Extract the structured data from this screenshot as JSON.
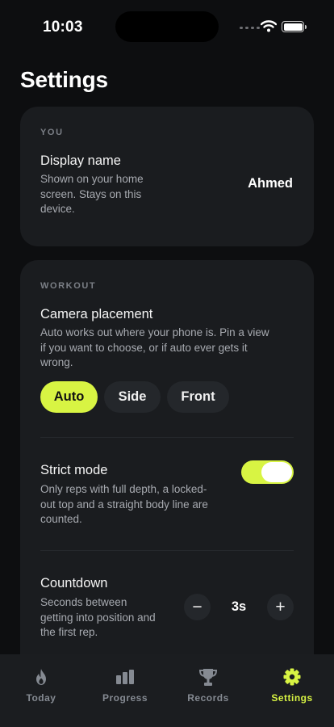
{
  "status_bar": {
    "time": "10:03"
  },
  "page": {
    "title": "Settings"
  },
  "you_section": {
    "label": "YOU",
    "display_name": {
      "title": "Display name",
      "description_lines": [
        "Shown on your home",
        "screen. Stays on this",
        "device."
      ],
      "value": "Ahmed"
    }
  },
  "workout_section": {
    "label": "WORKOUT",
    "camera_placement": {
      "title": "Camera placement",
      "description_lines": [
        "Auto works out where your phone is. Pin a view",
        "if you want to choose, or if auto ever gets it",
        "wrong."
      ],
      "options": [
        "Auto",
        "Side",
        "Front"
      ],
      "selected": "Auto"
    },
    "strict_mode": {
      "title": "Strict mode",
      "description_lines": [
        "Only reps with full depth, a locked-",
        "out top and a straight body line are",
        "counted."
      ],
      "enabled": true
    },
    "countdown": {
      "title": "Countdown",
      "description_lines": [
        "Seconds between",
        "getting into position and",
        "the first rep."
      ],
      "value": "3s",
      "minus_symbol": "−",
      "plus_symbol": "+"
    }
  },
  "tab_bar": {
    "tabs": [
      {
        "label": "Today",
        "icon": "flame-icon"
      },
      {
        "label": "Progress",
        "icon": "bar-chart-icon"
      },
      {
        "label": "Records",
        "icon": "trophy-icon"
      },
      {
        "label": "Settings",
        "icon": "gear-icon"
      }
    ],
    "active_index": 3
  },
  "colors": {
    "background": "#0d0e10",
    "card": "#1a1c1f",
    "accent": "#d8f443",
    "inactive_tab": "#858a92",
    "muted_text": "#a7aab0"
  }
}
